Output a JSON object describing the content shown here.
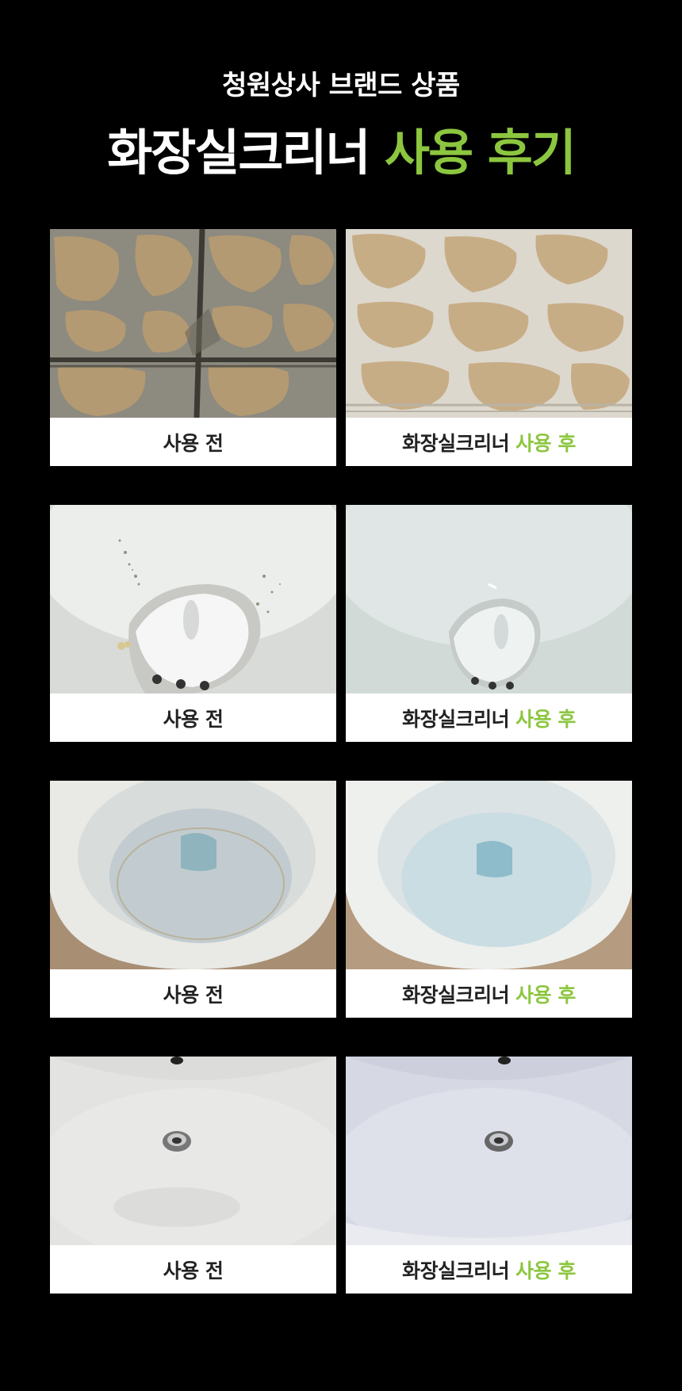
{
  "header": {
    "subtitle": "청원상사 브랜드 상품",
    "title_main": "화장실크리너",
    "title_accent": "사용 후기"
  },
  "colors": {
    "background": "#000000",
    "accent": "#8cc63f",
    "caption_text": "#222222"
  },
  "comparisons": [
    {
      "before": {
        "label": "사용 전"
      },
      "after": {
        "label_main": "화장실크리너",
        "label_accent": "사용 후"
      }
    },
    {
      "before": {
        "label": "사용 전"
      },
      "after": {
        "label_main": "화장실크리너",
        "label_accent": "사용 후"
      }
    },
    {
      "before": {
        "label": "사용 전"
      },
      "after": {
        "label_main": "화장실크리너",
        "label_accent": "사용 후"
      }
    },
    {
      "before": {
        "label": "사용 전"
      },
      "after": {
        "label_main": "화장실크리너",
        "label_accent": "사용 후"
      }
    }
  ]
}
